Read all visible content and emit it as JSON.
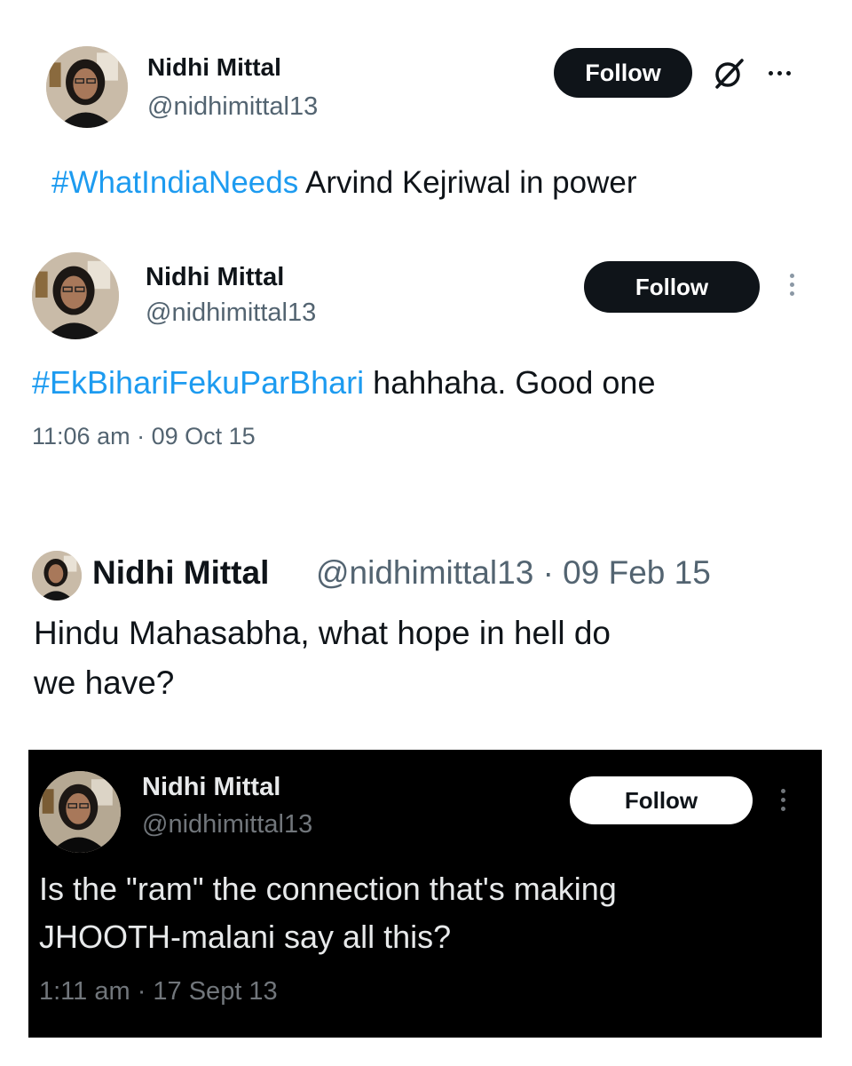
{
  "tweets": [
    {
      "name": "Nidhi Mittal",
      "handle": "@nidhimittal13",
      "follow_label": "Follow",
      "hashtag": "#WhatIndiaNeeds",
      "body": " Arvind Kejriwal in power"
    },
    {
      "name": "Nidhi Mittal",
      "handle": "@nidhimittal13",
      "follow_label": "Follow",
      "hashtag": "#EkBihariFekuParBhari",
      "body": " hahhaha. Good one",
      "timestamp": "11:06 am · 09 Oct 15"
    },
    {
      "name": "Nidhi Mittal",
      "handle_date": "@nidhimittal13 · 09 Feb 15",
      "body_line1": "Hindu Mahasabha, what hope in hell do",
      "body_line2": "we have?"
    },
    {
      "name": "Nidhi Mittal",
      "handle": "@nidhimittal13",
      "follow_label": "Follow",
      "body_line1": "Is the \"ram\" the connection that's making",
      "body_line2": "JHOOTH-malani say all this?",
      "timestamp": "1:11 am · 17 Sept 13"
    }
  ],
  "icons": {
    "grok": "grok-icon",
    "more": "more-options-icon",
    "avatar": "profile-photo"
  },
  "colors": {
    "hashtag": "#1d9bf0",
    "text": "#0f1419",
    "muted": "#536471",
    "dark_bg": "#000000"
  }
}
